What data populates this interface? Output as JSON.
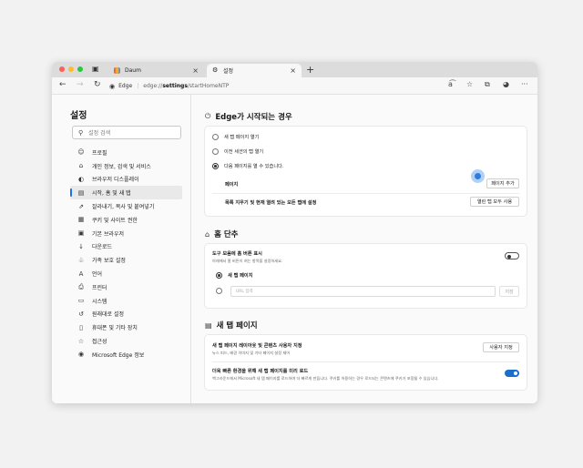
{
  "browser": {
    "tabs": [
      {
        "label": "Daum",
        "close": "×"
      },
      {
        "label": "설정",
        "close": "×"
      }
    ],
    "new_tab": "+",
    "address": {
      "site": "Edge",
      "url_prefix": "edge://",
      "url_bold": "settings",
      "url_rest": "/startHomeNTP"
    }
  },
  "sidebar": {
    "title": "설정",
    "search_placeholder": "설정 검색",
    "items": [
      {
        "label": "프로필",
        "icon": "profile-icon"
      },
      {
        "label": "개인 정보, 검색 및 서비스",
        "icon": "lock-icon"
      },
      {
        "label": "브라우저 디스플레이",
        "icon": "appearance-icon"
      },
      {
        "label": "시작, 홈 및 새 탭",
        "icon": "start-icon",
        "active": true
      },
      {
        "label": "잘라내기, 복사 및 붙여넣기",
        "icon": "share-icon"
      },
      {
        "label": "쿠키 및 사이트 권한",
        "icon": "cookie-icon"
      },
      {
        "label": "기본 브라우저",
        "icon": "default-browser-icon"
      },
      {
        "label": "다운로드",
        "icon": "download-icon"
      },
      {
        "label": "가족 보호 설정",
        "icon": "family-icon"
      },
      {
        "label": "언어",
        "icon": "language-icon"
      },
      {
        "label": "프린터",
        "icon": "printer-icon"
      },
      {
        "label": "시스템",
        "icon": "system-icon"
      },
      {
        "label": "원래대로 설정",
        "icon": "reset-icon"
      },
      {
        "label": "휴대폰 및 기타 장치",
        "icon": "phone-icon"
      },
      {
        "label": "접근성",
        "icon": "accessibility-icon"
      },
      {
        "label": "Microsoft Edge 정보",
        "icon": "edge-icon"
      }
    ]
  },
  "startup": {
    "title": "Edge가 시작되는 경우",
    "options": [
      {
        "label": "새 탭 페이지 열기",
        "selected": false
      },
      {
        "label": "이전 세션의 탭 열기",
        "selected": false
      },
      {
        "label": "다음 페이지를 열 수 있습니다.",
        "selected": true
      }
    ],
    "pages_label": "페이지",
    "add_page_button": "페이지 추가",
    "replace_label": "목록 지우기 및 현재 열려 있는 모든 탭에 설정",
    "use_open_tabs_button": "열린 탭 모두 사용"
  },
  "home": {
    "title": "홈 단추",
    "show_label": "도구 모음에 홈 버튼 표시",
    "show_sub": "아래에서 홈 버튼이 여는 항목을 설정하세요.",
    "toggle_on": false,
    "option_newtab": "새 탭 페이지",
    "url_placeholder": "URL 입력",
    "save_button": "저장"
  },
  "newtab": {
    "title": "새 탭 페이지",
    "customize_label": "새 탭 페이지 레이아웃 및 콘텐츠 사용자 지정",
    "customize_sub": "뉴스 피드, 배경 이미지 및 기타 페이지 설정 제어",
    "customize_button": "사용자 지정",
    "preload_label": "더욱 빠른 환경을 위해 새 탭 페이지를 미리 로드",
    "preload_sub": "백그라운드에서 Microsoft 새 탭 페이지를 로드하여 더 빠르게 만듭니다. 쿠키를 허용하는 경우 로드되는 콘텐츠에 쿠키가 포함될 수 있습니다.",
    "preload_on": true
  },
  "colors": {
    "accent": "#1a6fcc",
    "traffic_red": "#ff5f57",
    "traffic_yellow": "#febc2e",
    "traffic_green": "#28c840"
  }
}
